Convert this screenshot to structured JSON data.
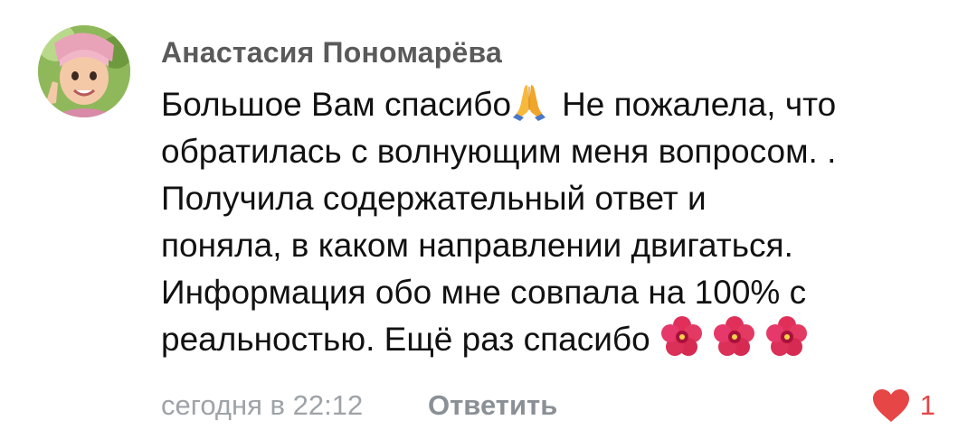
{
  "comment": {
    "author": "Анастасия Пономарёва",
    "avatar_icon": "avatar-photo",
    "text_lines": [
      "Большое Вам спасибо",
      "Не пожалела, что",
      "обратилась с волнующим меня вопросом. .",
      "Получила содержательный ответ и",
      "поняла, в каком направлении двигаться.",
      "Информация обо мне совпала на 100% с",
      "реальностью. Ещё раз спасибо"
    ],
    "emojis": {
      "after_line_1": "folded-hands",
      "after_last_line": [
        "hibiscus",
        "hibiscus",
        "hibiscus"
      ]
    },
    "timestamp": "сегодня в 22:12",
    "reply_label": "Ответить",
    "likes": "1",
    "colors": {
      "author": "#5a5a5a",
      "text": "#111111",
      "meta": "#9ea3a8",
      "like": "#e64646"
    }
  }
}
